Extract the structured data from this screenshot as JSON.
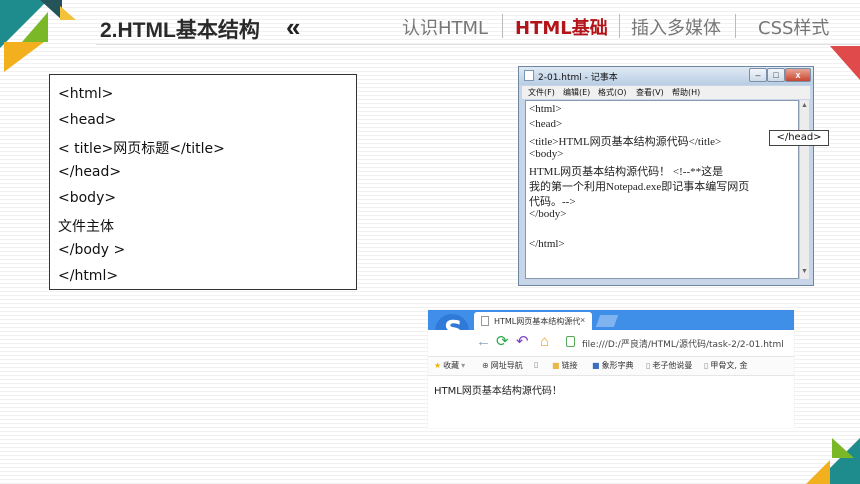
{
  "header": {
    "title": "2.HTML基本结构",
    "chevron": "«",
    "nav": [
      {
        "label": "认识HTML"
      },
      {
        "label": "HTML基础"
      },
      {
        "label": "插入多媒体"
      },
      {
        "label": "CSS样式"
      }
    ]
  },
  "code_box": {
    "lines": [
      "<html>",
      "<head>",
      "< title>网页标题</title>",
      "</head>",
      "<body>",
      "文件主体",
      "</body >",
      "</html>"
    ]
  },
  "notepad": {
    "title": "2-01.html - 记事本",
    "buttons": {
      "minimize": "–",
      "maximize": "□",
      "close": "x"
    },
    "menu": [
      "文件(F)",
      "编辑(E)",
      "格式(O)",
      "查看(V)",
      "帮助(H)"
    ],
    "lines": [
      "<html>",
      "<head>",
      "<title>HTML网页基本结构源代码</title>",
      "<body>",
      "HTML网页基本结构源代码！      <!--**这是",
      "我的第一个利用Notepad.exe即记事本编写网页",
      "代码。-->",
      "</body>",
      "",
      "</html>"
    ],
    "tooltip": "</head>"
  },
  "browser": {
    "logo": "S",
    "tab_title": "HTML网页基本结构源代",
    "tab_close": "×",
    "url": "file:///D:/严良清/HTML/源代码/task-2/2-01.html",
    "bookmarks": [
      "收藏",
      "网址导航",
      "链接",
      "象形字典",
      "老子他说曼",
      "甲骨文, 金"
    ],
    "content": "HTML网页基本结构源代码！"
  },
  "colors": {
    "accent_red": "#b2141a",
    "teal": "#1e8c8c",
    "yellow": "#f2b01e",
    "green": "#7ab828"
  }
}
